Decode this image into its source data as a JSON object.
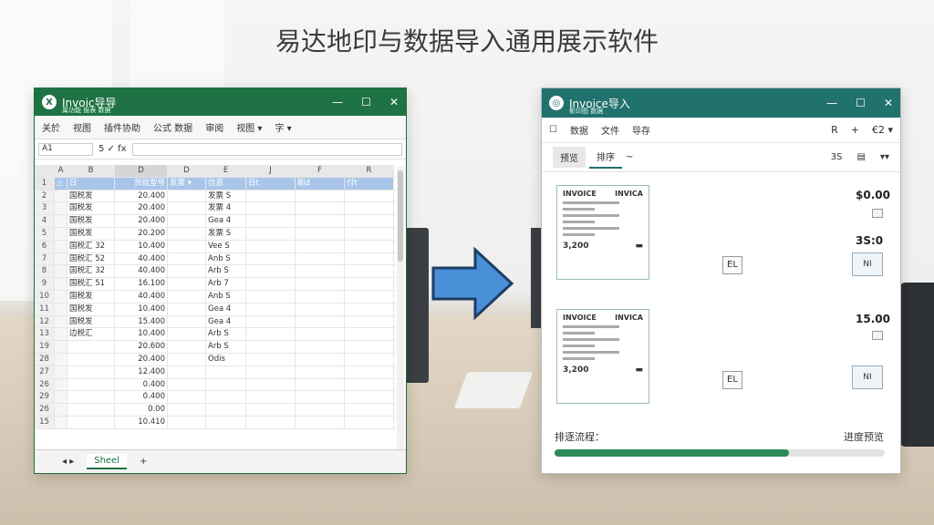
{
  "headline": "易达地印与数据导入通用展示软件",
  "excel": {
    "title": "Invoic导导",
    "subtitle": "属功能 报表 数据",
    "menu": [
      "关於",
      "视图",
      "插件协助",
      "公式 数据",
      "审阅",
      "视图 ▾",
      "字 ▾"
    ],
    "name_box": "A1",
    "formula_icons": "5 ✓ fx",
    "columns": [
      "",
      "A",
      "B",
      "D",
      "D",
      "E",
      "J",
      "F",
      "R"
    ],
    "header_row": [
      "1",
      "△",
      "日",
      "货款型号",
      "发票 ▾",
      "信息",
      "日t",
      "刷d",
      "付t"
    ],
    "rows": [
      [
        "2",
        "",
        "国税发",
        "20.400",
        "",
        "发票 S"
      ],
      [
        "3",
        "",
        "国税发",
        "20.400",
        "",
        "发票 4"
      ],
      [
        "4",
        "",
        "国税发",
        "20.400",
        "",
        "Gea 4"
      ],
      [
        "5",
        "",
        "国税发",
        "20.200",
        "",
        "发票 S"
      ],
      [
        "6",
        "",
        "国税汇 32",
        "10.400",
        "",
        "Vee S"
      ],
      [
        "7",
        "",
        "国税汇 52",
        "40.400",
        "",
        "Anb S"
      ],
      [
        "8",
        "",
        "国税汇 32",
        "40.400",
        "",
        "Arb S"
      ],
      [
        "9",
        "",
        "国税汇 51",
        "16.100",
        "",
        "Arb 7"
      ],
      [
        "10",
        "",
        "国税发",
        "40.400",
        "",
        "Anb S"
      ],
      [
        "11",
        "",
        "国税发",
        "10.400",
        "",
        "Gea 4"
      ],
      [
        "12",
        "",
        "国税发",
        "15.400",
        "",
        "Gea 4"
      ],
      [
        "13",
        "",
        "边税汇",
        "10.400",
        "",
        "Arb S"
      ],
      [
        "19",
        "",
        "",
        "20.600",
        "",
        "Arb S"
      ],
      [
        "28",
        "",
        "",
        "20.400",
        "",
        "Odis"
      ],
      [
        "27",
        "",
        "",
        "12.400",
        "",
        ""
      ],
      [
        "26",
        "",
        "",
        "0.400",
        "",
        ""
      ],
      [
        "29",
        "",
        "",
        "0.400",
        "",
        ""
      ],
      [
        "26",
        "",
        "",
        "0.00",
        "",
        ""
      ],
      [
        "15",
        "",
        "",
        "10.410",
        "",
        ""
      ]
    ],
    "sheet_tab": "Sheel"
  },
  "viewer": {
    "title": "Invoice导入",
    "subtitle": "影印图 数据",
    "menu": [
      "数据",
      "文件",
      "导存"
    ],
    "menu_right": [
      "R",
      "+",
      "€2 ▾"
    ],
    "tabs": [
      "预览",
      "排序"
    ],
    "tab_extra": "~",
    "tabs_right": [
      "3S",
      "▤",
      "▾▾"
    ],
    "invoice_head_l": "INVOICE",
    "invoice_head_r": "INVICA",
    "invoice_total_1": "3,200",
    "invoice_total_2": "3,200",
    "amounts": [
      "$0.00",
      "3S:0",
      "15.00"
    ],
    "badge_1": "EL",
    "badge_2": "EL",
    "badge2_1": "NI",
    "badge2_2": "NI",
    "progress_label_left": "排逐流程：",
    "progress_label_right": "进度预览",
    "progress": 0.71,
    "progress_color": "#2e8b57"
  }
}
